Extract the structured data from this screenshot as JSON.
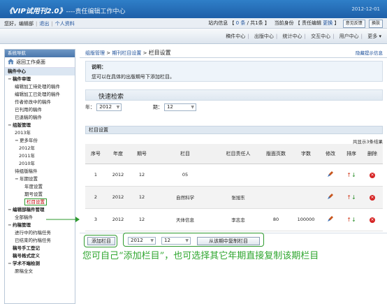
{
  "header": {
    "logo": "《VIP试用刊2.0》",
    "logo_sub": "----责任编辑工作中心",
    "date": "2012-12-01"
  },
  "userbar": {
    "greeting": "您好，编辑部",
    "logout": "退出",
    "profile": "个人资料",
    "inbox_prefix": "站内信息 【",
    "inbox_new": "0 条",
    "inbox_mid": "/ 共1条",
    "inbox_suffix": "】",
    "identity_prefix": "当前身份 【",
    "identity_role": "责任编辑",
    "identity_switch": "更换",
    "identity_suffix": "】",
    "feedback": "意见反馈",
    "switch": "换肤"
  },
  "nav": {
    "tabs": [
      "稿件中心",
      "出版中心",
      "统计中心",
      "交互中心",
      "用户中心",
      "更多"
    ]
  },
  "sidebar": {
    "title": "系统导航",
    "home": "返回工作桌面",
    "section": "稿件中心",
    "items": [
      {
        "level": "l1",
        "sign": "−",
        "label": "稿件审理"
      },
      {
        "level": "l2",
        "label": "编辑加工待处理的稿件"
      },
      {
        "level": "l2",
        "label": "编辑加工已处理的稿件"
      },
      {
        "level": "l2",
        "label": "作者修改中的稿件"
      },
      {
        "level": "l2",
        "label": "已刊用的稿件"
      },
      {
        "level": "l2",
        "label": "已退稿的稿件"
      },
      {
        "level": "l1",
        "sign": "−",
        "label": "组版管理"
      },
      {
        "level": "l2",
        "label": "2013年"
      },
      {
        "level": "l2",
        "sign": "−",
        "label": "更多年份"
      },
      {
        "level": "l3",
        "label": "2012年"
      },
      {
        "level": "l3",
        "label": "2011年"
      },
      {
        "level": "l3",
        "label": "2010年"
      },
      {
        "level": "l2",
        "label": "待组版稿件"
      },
      {
        "level": "l2",
        "sign": "−",
        "label": "年期设置"
      },
      {
        "level": "l4",
        "label": "年度设置"
      },
      {
        "level": "l4",
        "label": "期号设置"
      },
      {
        "level": "l4",
        "label": "栏目设置",
        "active": true
      },
      {
        "level": "l1",
        "sign": "−",
        "label": "编辑部稿件管理"
      },
      {
        "level": "l2",
        "label": "全部稿件"
      },
      {
        "level": "l1",
        "sign": "−",
        "label": "约稿管理"
      },
      {
        "level": "l2",
        "label": "进行中的约稿任务"
      },
      {
        "level": "l2",
        "label": "已结束的约稿任务"
      },
      {
        "level": "l1",
        "sign": "",
        "label": "稿号手工登记"
      },
      {
        "level": "l1",
        "sign": "",
        "label": "稿号格式定义"
      },
      {
        "level": "l1",
        "sign": "−",
        "label": "学术不端检测"
      },
      {
        "level": "l2",
        "label": "原稿全文"
      }
    ]
  },
  "breadcrumb": {
    "a": "组版管理",
    "b": "期刊栏目设置",
    "current": "栏目设置",
    "sep": ">"
  },
  "hide_tip": "隐藏提示信息",
  "note": {
    "title": "说明：",
    "text": "您可以在具体的出版期号下添加栏目。"
  },
  "quick_search": {
    "title": "快速检索",
    "year_label": "年：",
    "year_value": "2012",
    "issue_label": "期：",
    "issue_value": "12"
  },
  "column_section": {
    "title": "栏目设置",
    "total": "共显示3条结果"
  },
  "table": {
    "headers": [
      "序号",
      "年度",
      "期号",
      "栏目",
      "栏目责任人",
      "版面页数",
      "字数",
      "修改",
      "排序",
      "删除"
    ],
    "rows": [
      [
        "1",
        "2012",
        "12",
        "05",
        "",
        "",
        ""
      ],
      [
        "2",
        "2012",
        "12",
        "自然科学",
        "张旭东",
        "",
        ""
      ],
      [
        "3",
        "2012",
        "12",
        "天体信息",
        "李志忠",
        "80",
        "100000"
      ]
    ]
  },
  "bottom": {
    "add_button": "添加栏目",
    "year_value": "2012",
    "issue_value": "12",
    "copy_button": "从该期中复制栏目"
  },
  "annotation": "您可自己“添加栏目”，也可选择其它年期直接复制该期栏目",
  "colors": {
    "accent": "#1e5fa8",
    "highlight": "#2e9a2e",
    "annotation": "#2fa62f"
  }
}
